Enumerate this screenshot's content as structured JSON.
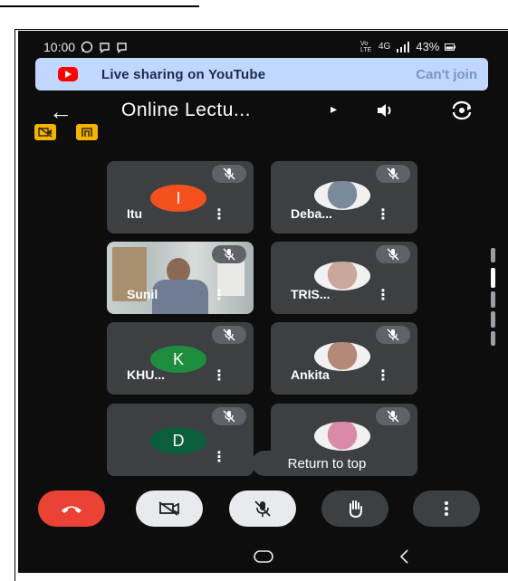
{
  "status_bar": {
    "time": "10:00",
    "notification_icons": [
      "whatsapp-icon",
      "messenger-icon",
      "messenger-icon"
    ],
    "network": "Vo LTE",
    "network2": "4G",
    "battery": "43%"
  },
  "banner": {
    "text": "Live sharing on YouTube",
    "action": "Can't join",
    "color": "#c2d7ff"
  },
  "header": {
    "title": "Online Lectu...",
    "title_arrow": "▸"
  },
  "participants": [
    {
      "name": "Itu",
      "initial": "I",
      "avatar_color": "#f4511e",
      "kind": "initial"
    },
    {
      "name": "Deba...",
      "initial": "",
      "avatar_color": "#7b8a9a",
      "kind": "photo"
    },
    {
      "name": "Sunil",
      "initial": "",
      "avatar_color": "#a7b3b6",
      "kind": "video"
    },
    {
      "name": "TRIS...",
      "initial": "",
      "avatar_color": "#c9a79a",
      "kind": "photo"
    },
    {
      "name": "KHU...",
      "initial": "K",
      "avatar_color": "#1e8e3e",
      "kind": "initial"
    },
    {
      "name": "Ankita",
      "initial": "",
      "avatar_color": "#b38978",
      "kind": "photo"
    },
    {
      "name": "",
      "initial": "D",
      "avatar_color": "#0b5e3b",
      "kind": "initial"
    },
    {
      "name": "",
      "initial": "",
      "avatar_color": "#d98aa6",
      "kind": "photo"
    }
  ],
  "toast": {
    "text": "Return to top"
  },
  "colors": {
    "end_call": "#ea4335",
    "control_light": "#e8eaed",
    "control_dark": "#3c4043",
    "tile": "#3c4043",
    "tag": "#f3b400"
  }
}
